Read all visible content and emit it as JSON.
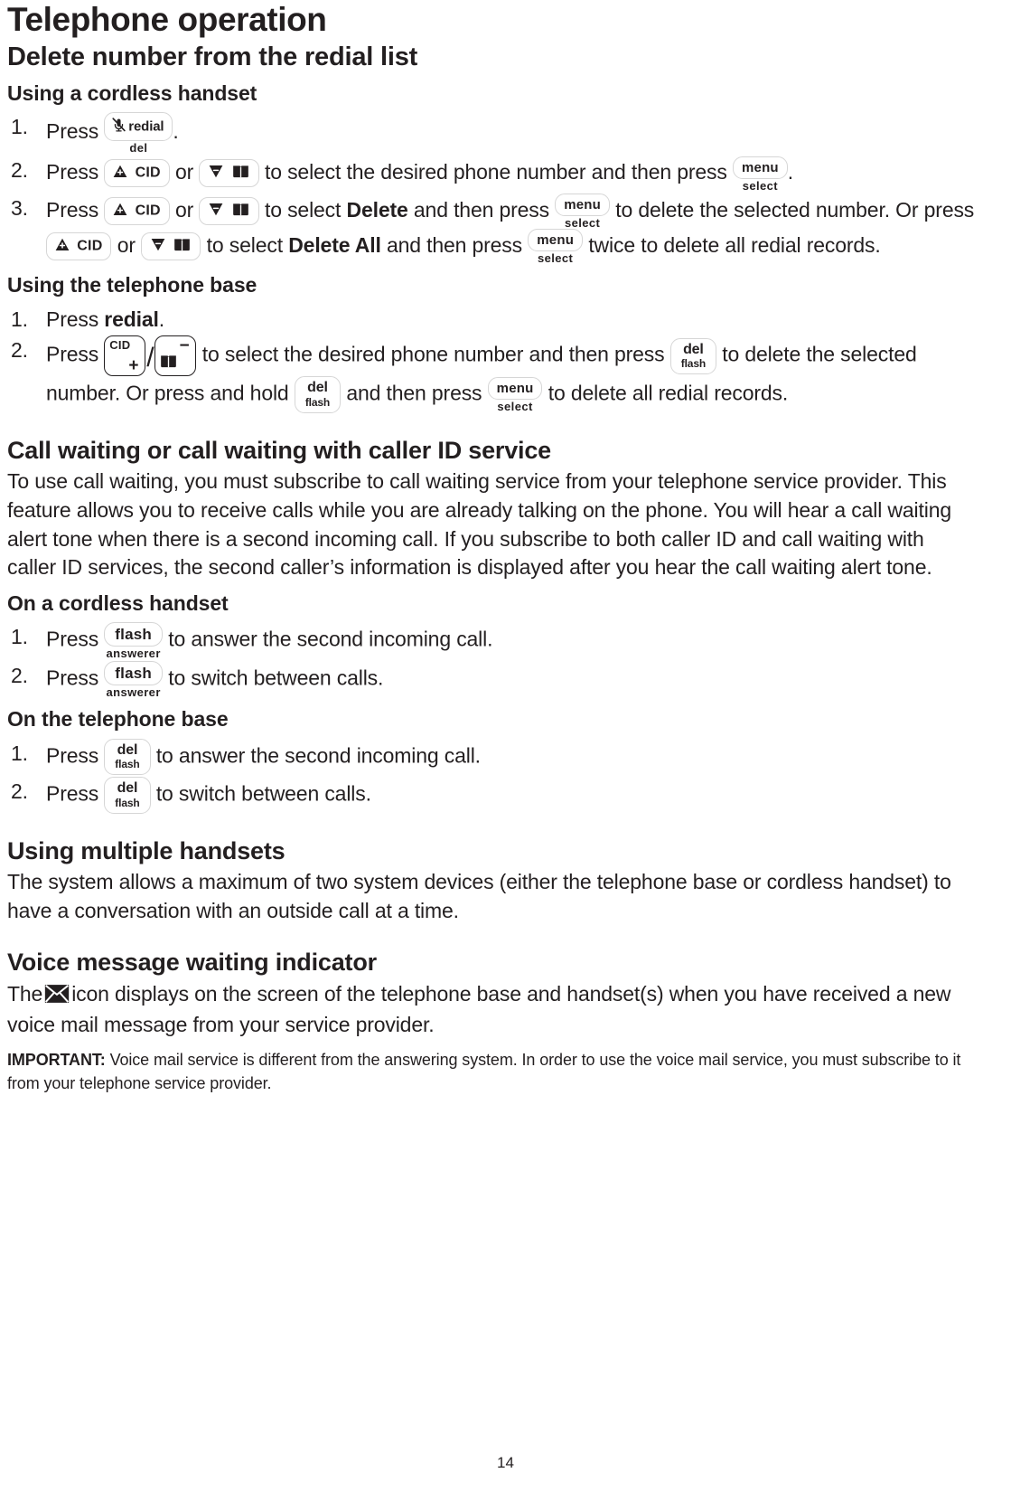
{
  "page": {
    "chapter_title": "Telephone operation",
    "page_number": "14"
  },
  "sections": {
    "delete_redial": {
      "title": "Delete number from the redial list",
      "cordless": {
        "subtitle": "Using a cordless handset",
        "steps": [
          {
            "num": "1.",
            "parts": [
              "Press",
              "[redial/del key]",
              "."
            ]
          },
          {
            "num": "2.",
            "parts": [
              "Press",
              "[CID up key]",
              "or",
              "[down phonebook key]",
              "to select the desired phone number and then press",
              "[menu/select key]",
              "."
            ]
          },
          {
            "num": "3.",
            "parts": [
              "Press",
              "[CID up key]",
              "or",
              "[down phonebook key]",
              "to select",
              "Delete",
              "and then press",
              "[menu/select key]",
              "to delete the selected number. Or press",
              "[CID up key]",
              "or",
              "[down phonebook key]",
              "to select",
              "Delete All",
              "and then press",
              "[menu/select key]",
              "twice to delete all redial records."
            ]
          }
        ],
        "step1_text_press": "Press",
        "step1_text_period": ".",
        "step2_press": "Press",
        "step2_or": "or",
        "step2_mid": "to select the desired phone number and then press",
        "step2_end": ".",
        "step3_press": "Press",
        "step3_or": "or",
        "step3_select": "to select",
        "step3_delete": "Delete",
        "step3_andthen": "and then press",
        "step3_todelete": "to delete the selected number. Or press",
        "step3_or2": "or",
        "step3_select2": "to select",
        "step3_deleteall": "Delete All",
        "step3_andthen2": "and then press",
        "step3_twice": "twice to delete all redial records."
      },
      "base": {
        "subtitle": "Using the telephone base",
        "step1_press": "Press",
        "step1_redial": "redial",
        "step1_period": ".",
        "step2_press": "Press",
        "step2_mid": "to select the desired phone number and then press",
        "step2_todelete": "to delete the selected number. Or press and hold",
        "step2_andthen": "and then press",
        "step2_end": "to delete all redial records."
      }
    },
    "call_waiting": {
      "title": "Call waiting or call waiting with caller ID service",
      "paragraph": "To use call waiting, you must subscribe to call waiting service from your telephone service provider. This feature allows you to receive calls while you are already talking on the phone. You will hear a call waiting alert tone when there is a second incoming call. If you subscribe to both caller ID and call waiting with caller ID services, the second caller’s information is displayed after you hear the call waiting alert tone.",
      "cordless": {
        "subtitle": "On a cordless handset",
        "step1_press": "Press",
        "step1_end": "to answer the second incoming call.",
        "step2_press": "Press",
        "step2_end": "to switch between calls."
      },
      "base": {
        "subtitle": "On the telephone base",
        "step1_press": "Press",
        "step1_end": "to answer the second incoming call.",
        "step2_press": "Press",
        "step2_end": "to switch between calls."
      }
    },
    "multiple_handsets": {
      "title": "Using multiple handsets",
      "paragraph": "The system allows a maximum of two system devices (either the telephone base or cordless handset) to have a conversation with an outside call at a time."
    },
    "voice_message": {
      "title": "Voice message waiting indicator",
      "text_before": "The",
      "text_after": "icon displays on the screen of the telephone base and handset(s) when you have received a new voice mail message from your service provider.",
      "important_label": "IMPORTANT:",
      "important_text": "Voice mail service is different from the answering system. In order to use the voice mail service, you must subscribe to it from your telephone service provider."
    }
  },
  "keys": {
    "redial": {
      "label": "redial",
      "sub": "del",
      "icon": "mute-microphone-icon"
    },
    "cid_up": {
      "label": "CID",
      "icon": "triangle-up-plus-icon"
    },
    "down_book": {
      "icon_tri": "triangle-down-minus-icon",
      "icon_book": "phonebook-icon"
    },
    "menu_select": {
      "label": "menu",
      "sub": "select"
    },
    "del_flash": {
      "line1": "del",
      "line2": "flash"
    },
    "flash_answerer": {
      "label": "flash",
      "sub": "answerer"
    },
    "base_cid_plus": {
      "tl": "CID",
      "br": "+"
    },
    "base_book_minus": {
      "tr": "−",
      "icon": "phonebook-icon"
    },
    "separator": "/"
  },
  "icons": {
    "envelope": "envelope-icon"
  },
  "colors": {
    "text": "#231f20",
    "key_border": "#d6d6d6",
    "key_border_dark": "#231f20",
    "background": "#ffffff"
  }
}
